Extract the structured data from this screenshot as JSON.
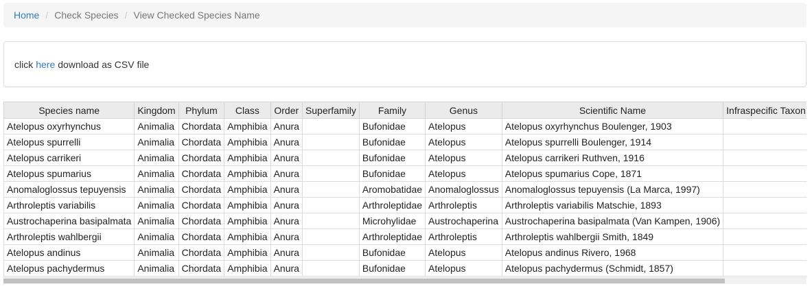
{
  "breadcrumb": {
    "home": "Home",
    "separator": "/",
    "check_species": "Check Species",
    "current": "View Checked Species Name"
  },
  "download_panel": {
    "prefix": "click",
    "link": "here",
    "suffix": "download as CSV file"
  },
  "table": {
    "columns": [
      "Species name",
      "Kingdom",
      "Phylum",
      "Class",
      "Order",
      "Superfamily",
      "Family",
      "Genus",
      "Scientific Name",
      "Infraspecific Taxon"
    ],
    "rows": [
      [
        "Atelopus oxyrhynchus",
        "Animalia",
        "Chordata",
        "Amphibia",
        "Anura",
        "",
        "Bufonidae",
        "Atelopus",
        "Atelopus oxyrhynchus Boulenger, 1903",
        ""
      ],
      [
        "Atelopus spurrelli",
        "Animalia",
        "Chordata",
        "Amphibia",
        "Anura",
        "",
        "Bufonidae",
        "Atelopus",
        "Atelopus spurrelli Boulenger, 1914",
        ""
      ],
      [
        "Atelopus carrikeri",
        "Animalia",
        "Chordata",
        "Amphibia",
        "Anura",
        "",
        "Bufonidae",
        "Atelopus",
        "Atelopus carrikeri Ruthven, 1916",
        ""
      ],
      [
        "Atelopus spumarius",
        "Animalia",
        "Chordata",
        "Amphibia",
        "Anura",
        "",
        "Bufonidae",
        "Atelopus",
        "Atelopus spumarius Cope, 1871",
        ""
      ],
      [
        "Anomaloglossus tepuyensis",
        "Animalia",
        "Chordata",
        "Amphibia",
        "Anura",
        "",
        "Aromobatidae",
        "Anomaloglossus",
        "Anomaloglossus tepuyensis (La Marca, 1997)",
        ""
      ],
      [
        "Arthroleptis variabilis",
        "Animalia",
        "Chordata",
        "Amphibia",
        "Anura",
        "",
        "Arthroleptidae",
        "Arthroleptis",
        "Arthroleptis variabilis Matschie, 1893",
        ""
      ],
      [
        "Austrochaperina basipalmata",
        "Animalia",
        "Chordata",
        "Amphibia",
        "Anura",
        "",
        "Microhylidae",
        "Austrochaperina",
        "Austrochaperina basipalmata (Van Kampen, 1906)",
        ""
      ],
      [
        "Arthroleptis wahlbergii",
        "Animalia",
        "Chordata",
        "Amphibia",
        "Anura",
        "",
        "Arthroleptidae",
        "Arthroleptis",
        "Arthroleptis wahlbergii Smith, 1849",
        ""
      ],
      [
        "Atelopus andinus",
        "Animalia",
        "Chordata",
        "Amphibia",
        "Anura",
        "",
        "Bufonidae",
        "Atelopus",
        "Atelopus andinus Rivero, 1968",
        ""
      ],
      [
        "Atelopus pachydermus",
        "Animalia",
        "Chordata",
        "Amphibia",
        "Anura",
        "",
        "Bufonidae",
        "Atelopus",
        "Atelopus pachydermus (Schmidt, 1857)",
        ""
      ]
    ]
  },
  "colors": {
    "link": "#337ab7",
    "breadcrumb_bg": "#f5f5f5",
    "header_bg": "#ebebeb"
  }
}
